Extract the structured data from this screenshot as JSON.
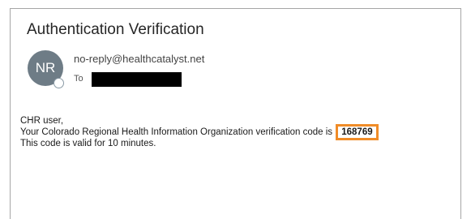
{
  "email": {
    "subject": "Authentication Verification",
    "avatar_initials": "NR",
    "sender": "no-reply@healthcatalyst.net",
    "to_label": "To",
    "greeting": "CHR user,",
    "message_prefix": "Your Colorado Regional Health Information Organization verification code is",
    "verification_code": "168769",
    "validity_text": "This code is valid for 10 minutes."
  },
  "colors": {
    "code_highlight_border": "#f08c28",
    "avatar_bg": "#6e7c86"
  },
  "icons": [
    "presence-status-icon"
  ]
}
